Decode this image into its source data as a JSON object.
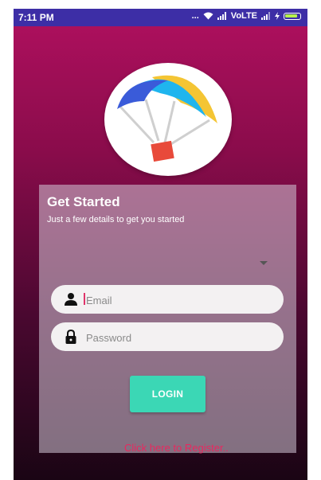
{
  "status_bar": {
    "time": "7:11 PM",
    "indicators": "... ",
    "network_label": "VoLTE",
    "icons": [
      "wifi-icon",
      "signal-icon",
      "signal-icon",
      "charging-icon",
      "battery-icon"
    ],
    "battery_level": 0.9,
    "battery_color": "#b6f24a",
    "background_color": "#3d2ea6"
  },
  "logo": {
    "icon": "parachute-logo-icon",
    "colors": [
      "#3a5bd9",
      "#1fb5ee",
      "#f4c534",
      "#e84a3a"
    ]
  },
  "card": {
    "title": "Get Started",
    "subtitle": "Just a few details to get you started",
    "dropdown_icon": "dropdown-arrow-icon"
  },
  "form": {
    "email": {
      "placeholder": "Email",
      "value": "",
      "icon": "person-icon"
    },
    "password": {
      "placeholder": "Password",
      "value": "",
      "icon": "lock-icon"
    },
    "login_label": "LOGIN",
    "login_color": "#3bd7b5",
    "register_link": "Click here to Register..",
    "register_color": "#e8285f"
  },
  "theme": {
    "background_top": "#b0105f",
    "background_bottom": "#1a0514"
  }
}
